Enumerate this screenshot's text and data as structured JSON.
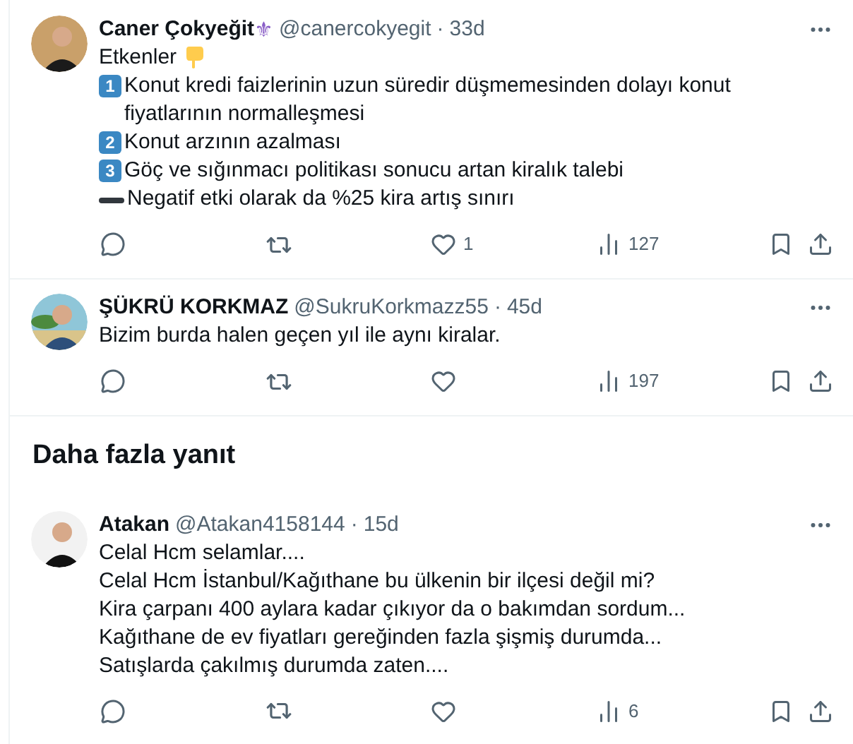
{
  "replies": [
    {
      "name": "Caner Çokyeğit",
      "name_emoji": "⚜",
      "handle": "@canercokyegit",
      "separator": "·",
      "time": "33d",
      "lines": [
        {
          "kind": "plain",
          "text": "Etkenler",
          "pointing_hand": true
        },
        {
          "kind": "keycap",
          "mark": "1",
          "text": "Konut kredi faizlerinin uzun süredir düşmemesinden dolayı konut fiyatlarının normalleşmesi"
        },
        {
          "kind": "keycap",
          "mark": "2",
          "text": "Konut arzının azalması"
        },
        {
          "kind": "keycap",
          "mark": "3",
          "text": "Göç ve sığınmacı politikası sonucu artan kiralık talebi"
        },
        {
          "kind": "dash",
          "text": "Negatif etki olarak da %25 kira artış sınırı"
        }
      ],
      "likes": "1",
      "views": "127"
    },
    {
      "name": "ŞÜKRÜ KORKMAZ",
      "handle": "@SukruKorkmazz55",
      "separator": "·",
      "time": "45d",
      "lines": [
        {
          "kind": "plain",
          "text": "Bizim burda halen geçen yıl ile aynı kiralar."
        }
      ],
      "views": "197"
    }
  ],
  "more_heading": "Daha fazla yanıt",
  "more_replies": [
    {
      "name": "Atakan",
      "handle": "@Atakan4158144",
      "separator": "·",
      "time": "15d",
      "lines": [
        {
          "kind": "plain",
          "text": "Celal Hcm selamlar...."
        },
        {
          "kind": "plain",
          "text": "Celal Hcm İstanbul/Kağıthane bu ülkenin bir ilçesi değil mi?"
        },
        {
          "kind": "plain",
          "text": "Kira çarpanı 400 aylara kadar çıkıyor da o bakımdan sordum..."
        },
        {
          "kind": "plain",
          "text": "Kağıthane de ev fiyatları gereğinden fazla şişmiş durumda..."
        },
        {
          "kind": "plain",
          "text": "Satışlarda çakılmış durumda zaten...."
        }
      ],
      "views": "6"
    }
  ]
}
